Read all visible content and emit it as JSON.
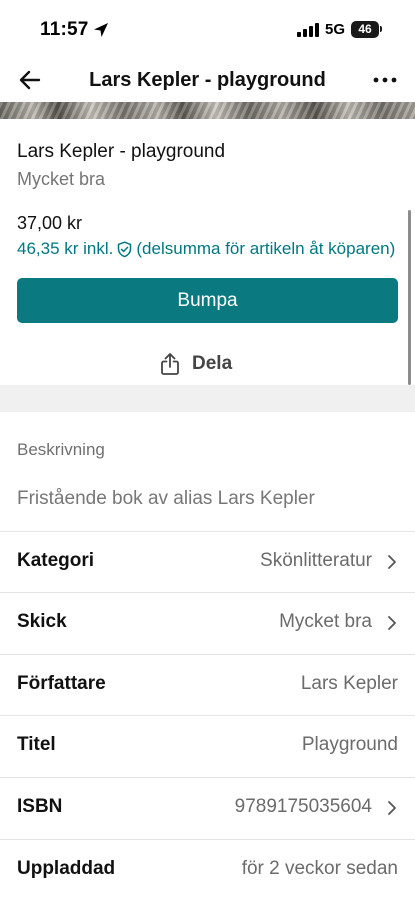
{
  "status_bar": {
    "time": "11:57",
    "network": "5G",
    "battery": "46"
  },
  "nav": {
    "title": "Lars Kepler - playground",
    "back_icon": "arrow-left-icon",
    "more_icon": "more-horizontal-icon"
  },
  "item": {
    "title": "Lars Kepler - playground",
    "condition": "Mycket bra",
    "price": "37,00 kr",
    "price_incl": "46,35 kr inkl.",
    "buyer_protection_text": "(delsumma för artikeln åt köparen)"
  },
  "actions": {
    "bump_label": "Bumpa",
    "share_label": "Dela"
  },
  "description": {
    "heading": "Beskrivning",
    "text": "Fristående bok av alias Lars Kepler"
  },
  "attributes": [
    {
      "label": "Kategori",
      "value": "Skönlitteratur",
      "has_chevron": true
    },
    {
      "label": "Skick",
      "value": "Mycket bra",
      "has_chevron": true
    },
    {
      "label": "Författare",
      "value": "Lars Kepler",
      "has_chevron": false
    },
    {
      "label": "Titel",
      "value": "Playground",
      "has_chevron": false
    },
    {
      "label": "ISBN",
      "value": "9789175035604",
      "has_chevron": true
    },
    {
      "label": "Uppladdad",
      "value": "för 2 veckor sedan",
      "has_chevron": false
    }
  ],
  "colors": {
    "accent": "#0b7a80",
    "link": "#007782",
    "divider": "#f0f0f0"
  }
}
